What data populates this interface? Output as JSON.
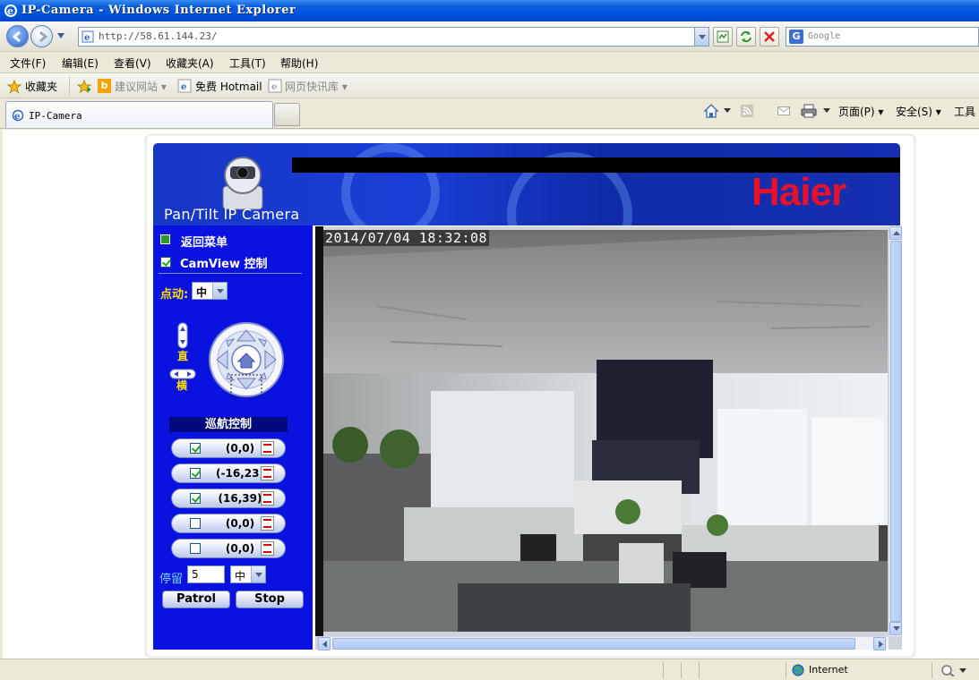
{
  "window": {
    "title": "IP-Camera - Windows Internet Explorer"
  },
  "address": {
    "url": "http://58.61.144.23/",
    "search_placeholder": "Google"
  },
  "menu": [
    "文件(F)",
    "编辑(E)",
    "查看(V)",
    "收藏夹(A)",
    "工具(T)",
    "帮助(H)"
  ],
  "favorites": {
    "label": "收藏夹",
    "items": [
      "建议网站 ▾",
      "免费 Hotmail",
      "网页快讯库 ▾"
    ]
  },
  "tabs": {
    "active": "IP-Camera"
  },
  "command_bar": {
    "page": "页面(P) ▾",
    "safety": "安全(S) ▾",
    "tools": "工具"
  },
  "banner": {
    "title": "Pan/Tilt IP Camera",
    "brand": "Haier"
  },
  "panel": {
    "back_menu": "返回菜单",
    "camview": "CamView 控制",
    "jog_label": "点动:",
    "jog_value": "中",
    "vertical": "直",
    "horizontal": "横",
    "cruise_header": "巡航控制",
    "presets": [
      {
        "label": "(0,0)",
        "checked": true
      },
      {
        "label": "(-16,23)",
        "checked": true
      },
      {
        "label": "(16,39)",
        "checked": true
      },
      {
        "label": "(0,0)",
        "checked": false
      },
      {
        "label": "(0,0)",
        "checked": false
      }
    ],
    "dwell_label": "停留",
    "dwell_value": "5",
    "dwell_speed": "中",
    "patrol": "Patrol",
    "stop": "Stop"
  },
  "video": {
    "timestamp": "2014/07/04  18:32:08"
  },
  "status": {
    "zone": "Internet"
  }
}
